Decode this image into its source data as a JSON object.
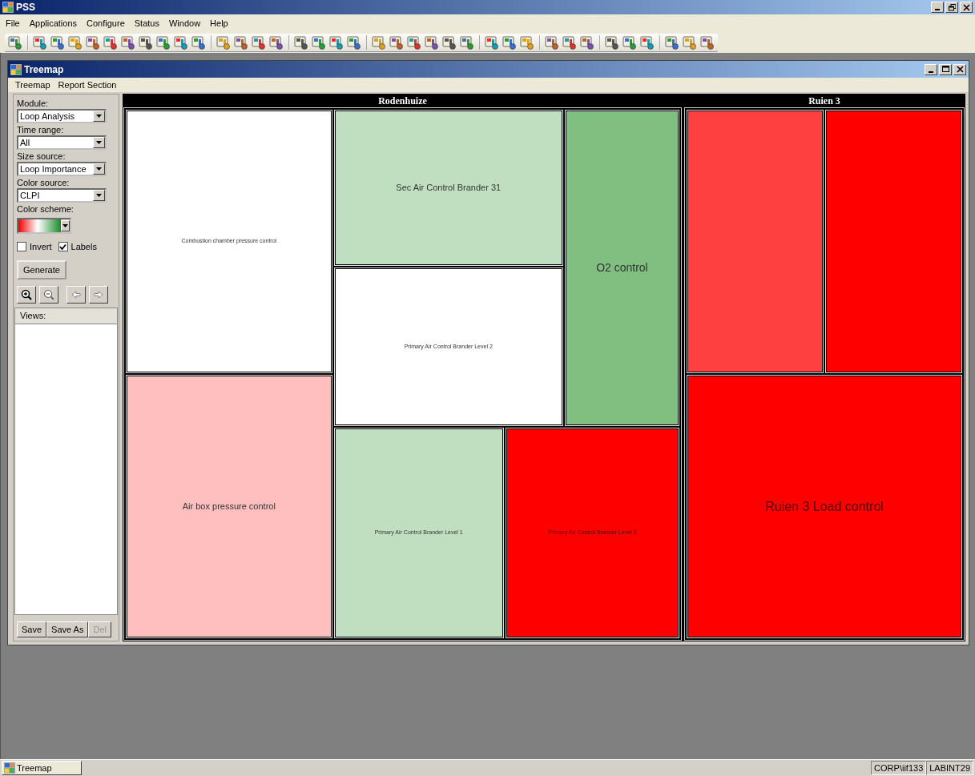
{
  "app": {
    "title": "PSS"
  },
  "menu": [
    "File",
    "Applications",
    "Configure",
    "Status",
    "Window",
    "Help"
  ],
  "child_window": {
    "title": "Treemap",
    "menu": [
      "Treemap",
      "Report Section"
    ]
  },
  "controls": [
    {
      "label": "Module:",
      "value": "Loop Analysis"
    },
    {
      "label": "Time range:",
      "value": "All"
    },
    {
      "label": "Size source:",
      "value": "Loop Importance"
    },
    {
      "label": "Color source:",
      "value": "CLPI"
    }
  ],
  "color_scheme": {
    "label": "Color scheme:"
  },
  "checkboxes": [
    {
      "label": "Invert",
      "checked": false
    },
    {
      "label": "Labels",
      "checked": true
    }
  ],
  "generate_button": "Generate",
  "views": {
    "header": "Views:"
  },
  "view_buttons": [
    {
      "label": "Save",
      "disabled": false
    },
    {
      "label": "Save As",
      "disabled": false
    },
    {
      "label": "Del",
      "disabled": true
    }
  ],
  "treemap": {
    "groups": [
      {
        "title": "Rodenhuize",
        "cells": [
          {
            "label": "Combustion chamber pressure control",
            "color": "#ffffff",
            "kind": "s"
          },
          {
            "label": "Air box pressure control",
            "color": "#ffbfbf",
            "kind": "m"
          },
          {
            "label": "Sec Air Control Brander 31",
            "color": "#c0dfc0",
            "kind": "m"
          },
          {
            "label": "Primary Air Control Brander Level 2",
            "color": "#ffffff",
            "kind": "s"
          },
          {
            "label": "O2 control",
            "color": "#80bf80",
            "kind": "l"
          },
          {
            "label": "Primary Air Control Brander Level 1",
            "color": "#c0dfc0",
            "kind": "xs"
          },
          {
            "label": "Primary Air Control Brander Level 3",
            "color": "#ff0000",
            "kind": "xs"
          }
        ]
      },
      {
        "title": "Ruien 3",
        "cells": [
          {
            "color": "#ff4040",
            "kind": "xs"
          },
          {
            "color": "#ff0000",
            "kind": "xs"
          },
          {
            "label": "Ruien 3 Load control",
            "color": "#ff0000",
            "kind": "xl"
          }
        ]
      }
    ]
  },
  "taskbar": {
    "item": "Treemap"
  },
  "status_bar": [
    "CORP\\iif133",
    "LABINT29"
  ]
}
